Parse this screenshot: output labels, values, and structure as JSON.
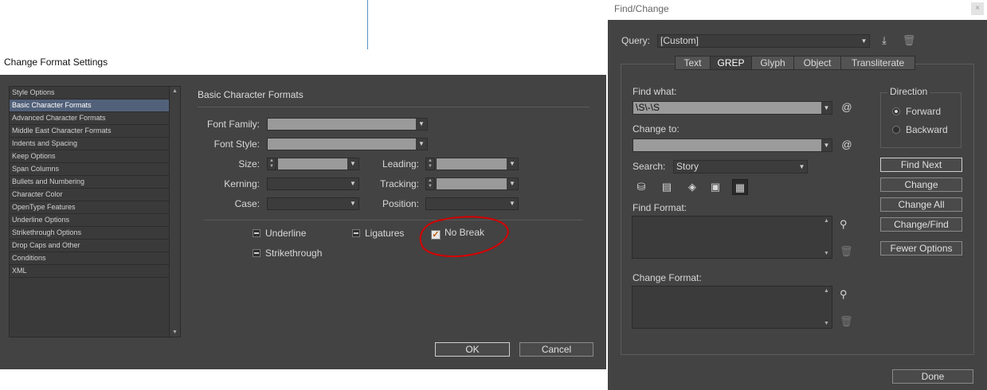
{
  "change_format": {
    "title": "Change Format Settings",
    "list_items": [
      "Style Options",
      "Basic Character Formats",
      "Advanced Character Formats",
      "Middle East Character Formats",
      "Indents and Spacing",
      "Keep Options",
      "Span Columns",
      "Bullets and Numbering",
      "Character Color",
      "OpenType Features",
      "Underline Options",
      "Strikethrough Options",
      "Drop Caps and Other",
      "Conditions",
      "XML"
    ],
    "selected_item": "Basic Character Formats",
    "section_title": "Basic Character Formats",
    "labels": {
      "font_family": "Font Family:",
      "font_style": "Font Style:",
      "size": "Size:",
      "leading": "Leading:",
      "kerning": "Kerning:",
      "tracking": "Tracking:",
      "case": "Case:",
      "position": "Position:"
    },
    "toggles": {
      "underline": "Underline",
      "ligatures": "Ligatures",
      "no_break": "No Break",
      "strikethrough": "Strikethrough"
    },
    "no_break_checked": true,
    "ok_label": "OK",
    "cancel_label": "Cancel"
  },
  "find_change": {
    "title": "Find/Change",
    "close_glyph": "×",
    "query_label": "Query:",
    "query_value": "[Custom]",
    "tabs": [
      "Text",
      "GREP",
      "Glyph",
      "Object",
      "Transliterate"
    ],
    "active_tab": "GREP",
    "find_what_label": "Find what:",
    "find_what_value": "\\S\\-\\S",
    "change_to_label": "Change to:",
    "change_to_value": "",
    "at_symbol": "@",
    "search_label": "Search:",
    "search_value": "Story",
    "find_format_label": "Find Format:",
    "change_format_label": "Change Format:",
    "direction_label": "Direction",
    "forward_label": "Forward",
    "backward_label": "Backward",
    "direction_selected": "Forward",
    "buttons": {
      "find_next": "Find Next",
      "change": "Change",
      "change_all": "Change All",
      "change_find": "Change/Find",
      "fewer_options": "Fewer Options",
      "done": "Done"
    },
    "icons": [
      "save-query-icon",
      "delete-query-icon",
      "include-locked-layers-icon",
      "include-locked-stories-icon",
      "include-hidden-layers-icon",
      "include-master-pages-icon",
      "include-footnotes-icon",
      "specify-attributes-icon",
      "clear-attributes-icon"
    ]
  },
  "colors": {
    "panel_bg": "#434343",
    "selected_list_bg": "#52617a",
    "annotation_red": "#d40000",
    "checkbox_mark": "#c05a00"
  }
}
